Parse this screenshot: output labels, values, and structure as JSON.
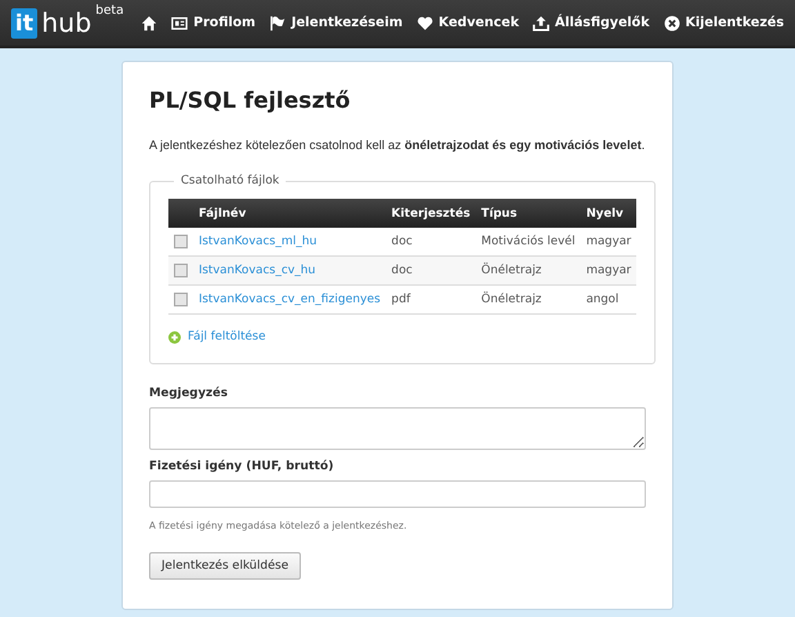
{
  "brand": {
    "logo_left": "it",
    "logo_right": "hub",
    "tag": "beta"
  },
  "nav": [
    {
      "kind": "home"
    },
    {
      "kind": "profile",
      "label": "Profilom"
    },
    {
      "kind": "flag",
      "label": "Jelentkezéseim"
    },
    {
      "kind": "heart",
      "label": "Kedvencek"
    },
    {
      "kind": "upload",
      "label": "Állásfigyelők"
    },
    {
      "kind": "close",
      "label": "Kijelentkezés"
    }
  ],
  "title": "PL/SQL fejlesztő",
  "intro": "A jelentkezéshez kötelezően csatolnod kell az **önéletrajzodat és egy motivációs levelet**.",
  "files": {
    "legend": "Csatolható fájlok",
    "columns": [
      "Fájlnév",
      "Kiterjesztés",
      "Típus",
      "Nyelv"
    ],
    "rows": [
      {
        "checked": false,
        "name": "IstvanKovacs_ml_hu",
        "ext": "doc",
        "type": "Motivációs levél",
        "lang": "magyar"
      },
      {
        "checked": false,
        "name": "IstvanKovacs_cv_hu",
        "ext": "doc",
        "type": "Önéletrajz",
        "lang": "magyar"
      },
      {
        "checked": false,
        "name": "IstvanKovacs_cv_en_fizigenyes",
        "ext": "pdf",
        "type": "Önéletrajz",
        "lang": "angol"
      }
    ],
    "upload": "Fájl feltöltése"
  },
  "note": {
    "label": "Megjegyzés"
  },
  "salary": {
    "label": "Fizetési igény (HUF, bruttó)",
    "help": "A fizetési igény megadása kötelező a jelentkezéshez."
  },
  "submit": "Jelentkezés elküldése"
}
